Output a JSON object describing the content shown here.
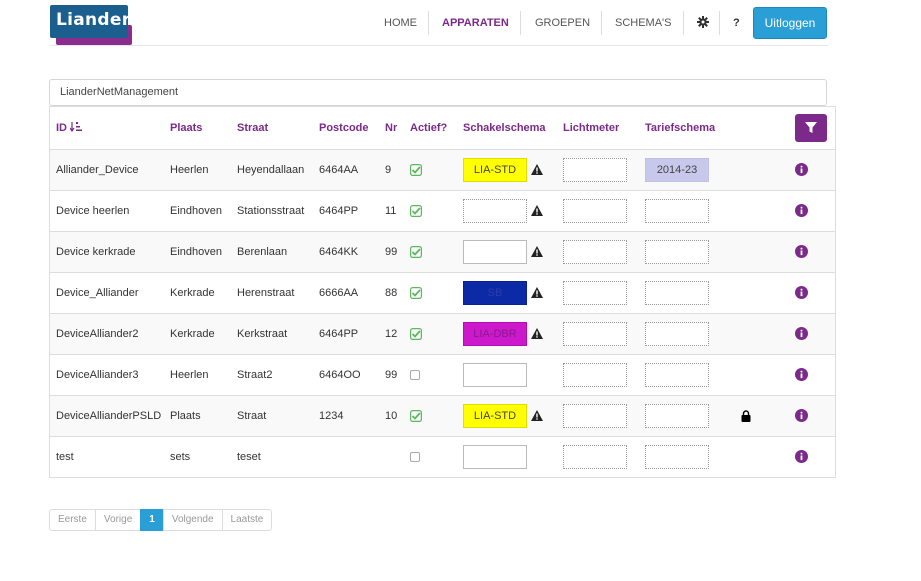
{
  "brand": {
    "logo_text": "Liander"
  },
  "nav": {
    "home": "HOME",
    "apparaten": "APPARATEN",
    "groepen": "GROEPEN",
    "schemas": "SCHEMA'S",
    "help": "?",
    "logout": "Uitloggen",
    "active": "apparaten"
  },
  "search": {
    "value": "LianderNetManagement"
  },
  "table": {
    "headers": {
      "id": "ID",
      "plaats": "Plaats",
      "straat": "Straat",
      "postcode": "Postcode",
      "nr": "Nr",
      "actief": "Actief?",
      "schakelschema": "Schakelschema",
      "lichtmeter": "Lichtmeter",
      "tariefschema": "Tariefschema"
    },
    "rows": [
      {
        "id": "Alliander_Device",
        "plaats": "Heerlen",
        "straat": "Heyendallaan",
        "postcode": "6464AA",
        "nr": "9",
        "actief": true,
        "schakel": "LIA-STD",
        "schakel_style": "yellow",
        "warning": true,
        "lichtmeter": "",
        "tarief": "2014-23",
        "tarief_style": "lav",
        "locked": false
      },
      {
        "id": "Device heerlen",
        "plaats": "Eindhoven",
        "straat": "Stationsstraat",
        "postcode": "6464PP",
        "nr": "11",
        "actief": true,
        "schakel": "",
        "schakel_style": "dotted",
        "warning": true,
        "lichtmeter": "",
        "tarief": "",
        "tarief_style": "dotted",
        "locked": false
      },
      {
        "id": "Device kerkrade",
        "plaats": "Eindhoven",
        "straat": "Berenlaan",
        "postcode": "6464KK",
        "nr": "99",
        "actief": true,
        "schakel": "",
        "schakel_style": "plain",
        "warning": true,
        "lichtmeter": "",
        "tarief": "",
        "tarief_style": "dotted",
        "locked": false
      },
      {
        "id": "Device_Alliander",
        "plaats": "Kerkrade",
        "straat": "Herenstraat",
        "postcode": "6666AA",
        "nr": "88",
        "actief": true,
        "schakel": "SB",
        "schakel_style": "blue",
        "warning": true,
        "lichtmeter": "",
        "tarief": "",
        "tarief_style": "dotted",
        "locked": false
      },
      {
        "id": "DeviceAlliander2",
        "plaats": "Kerkrade",
        "straat": "Kerkstraat",
        "postcode": "6464PP",
        "nr": "12",
        "actief": true,
        "schakel": "LIA-DBR",
        "schakel_style": "magenta",
        "warning": true,
        "lichtmeter": "",
        "tarief": "",
        "tarief_style": "dotted",
        "locked": false
      },
      {
        "id": "DeviceAlliander3",
        "plaats": "Heerlen",
        "straat": "Straat2",
        "postcode": "6464OO",
        "nr": "99",
        "actief": false,
        "schakel": "",
        "schakel_style": "plain",
        "warning": false,
        "lichtmeter": "",
        "tarief": "",
        "tarief_style": "dotted",
        "locked": false
      },
      {
        "id": "DeviceAllianderPSLD",
        "plaats": "Plaats",
        "straat": "Straat",
        "postcode": "1234",
        "nr": "10",
        "actief": true,
        "schakel": "LIA-STD",
        "schakel_style": "yellow",
        "warning": true,
        "lichtmeter": "",
        "tarief": "",
        "tarief_style": "dotted",
        "locked": true
      },
      {
        "id": "test",
        "plaats": "sets",
        "straat": "teset",
        "postcode": "",
        "nr": "",
        "actief": false,
        "schakel": "",
        "schakel_style": "plain",
        "warning": false,
        "lichtmeter": "",
        "tarief": "",
        "tarief_style": "dotted",
        "locked": false
      }
    ]
  },
  "pagination": {
    "first": "Eerste",
    "prev": "Vorige",
    "current": "1",
    "next": "Volgende",
    "last": "Laatste"
  },
  "colors": {
    "brand_purple": "#7b2a8a",
    "primary_blue": "#2a9fd6",
    "logo_blue": "#1a5f8e",
    "check_green": "#5cb85c"
  },
  "icons": {
    "sort": "sort-alpha-icon",
    "filter": "filter-icon",
    "settings": "gear-icon",
    "active": "check-icon",
    "inactive": "empty-checkbox-icon",
    "warning": "warning-icon",
    "lock": "lock-icon",
    "info": "info-icon"
  }
}
